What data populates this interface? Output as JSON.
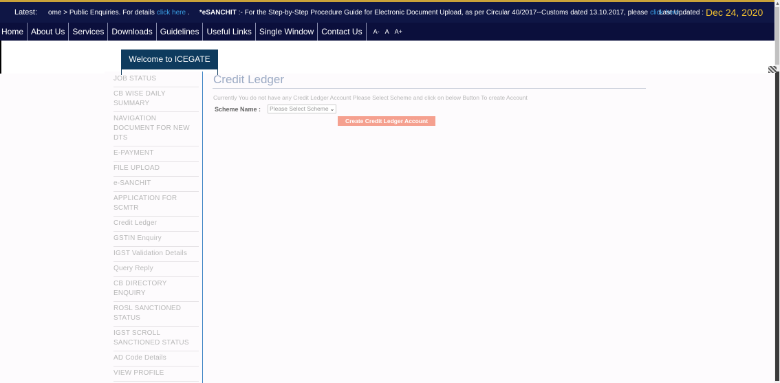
{
  "ticker": {
    "latest_label": "Latest:",
    "segment1": "ome > Public Enquiries. For details",
    "link1": "click here",
    "sep1": ".",
    "esanchit_bold": "*eSANCHIT",
    "segment2": ":- For the Step-by-Step Procedure Guide for Electronic Document Upload, as per Circular 40/2017--Customs dated 13.10.2017, please",
    "link2": "click here",
    "sep2": ".",
    "updated_label": "Last Updated :",
    "updated_date": "Dec 24, 2020"
  },
  "nav": {
    "items": [
      "Home",
      "About Us",
      "Services",
      "Downloads",
      "Guidelines",
      "Useful Links",
      "Single Window",
      "Contact Us"
    ],
    "font_controls": [
      "A-",
      "A",
      "A+"
    ]
  },
  "welcome": "Welcome to ICEGATE",
  "sidebar": {
    "items": [
      "JOB STATUS",
      "CB WISE DAILY SUMMARY",
      "NAVIGATION DOCUMENT FOR NEW DTS",
      "E-PAYMENT",
      "FILE UPLOAD",
      "e-SANCHIT",
      "APPLICATION FOR SCMTR",
      "Credit Ledger",
      "GSTIN Enquiry",
      "IGST Validation Details",
      "Query Reply",
      "CB DIRECTORY ENQUIRY",
      "ROSL SANCTIONED STATUS",
      "IGST SCROLL SANCTIONED STATUS",
      "AD Code Details",
      "VIEW PROFILE"
    ]
  },
  "main": {
    "title": "Credit Ledger",
    "info": "Currently You do not have any Credit Ledger Account Please Select Scheme and click on below Button To create Account",
    "scheme_label": "Scheme Name :",
    "scheme_select_value": "Please Select Scheme",
    "create_button": "Create Credit Ledger Account"
  },
  "colors": {
    "topbar": "#0f1645",
    "navbar": "#0b0f3c",
    "welcome_bg": "#0e3b5e",
    "link": "#3aa1e6",
    "date": "#f2c230",
    "button": "#f5a08f",
    "title": "#9aa9c3"
  },
  "icons": {
    "select_chevron": "chevron-down-icon",
    "scroll_up": "arrow-up-icon"
  }
}
